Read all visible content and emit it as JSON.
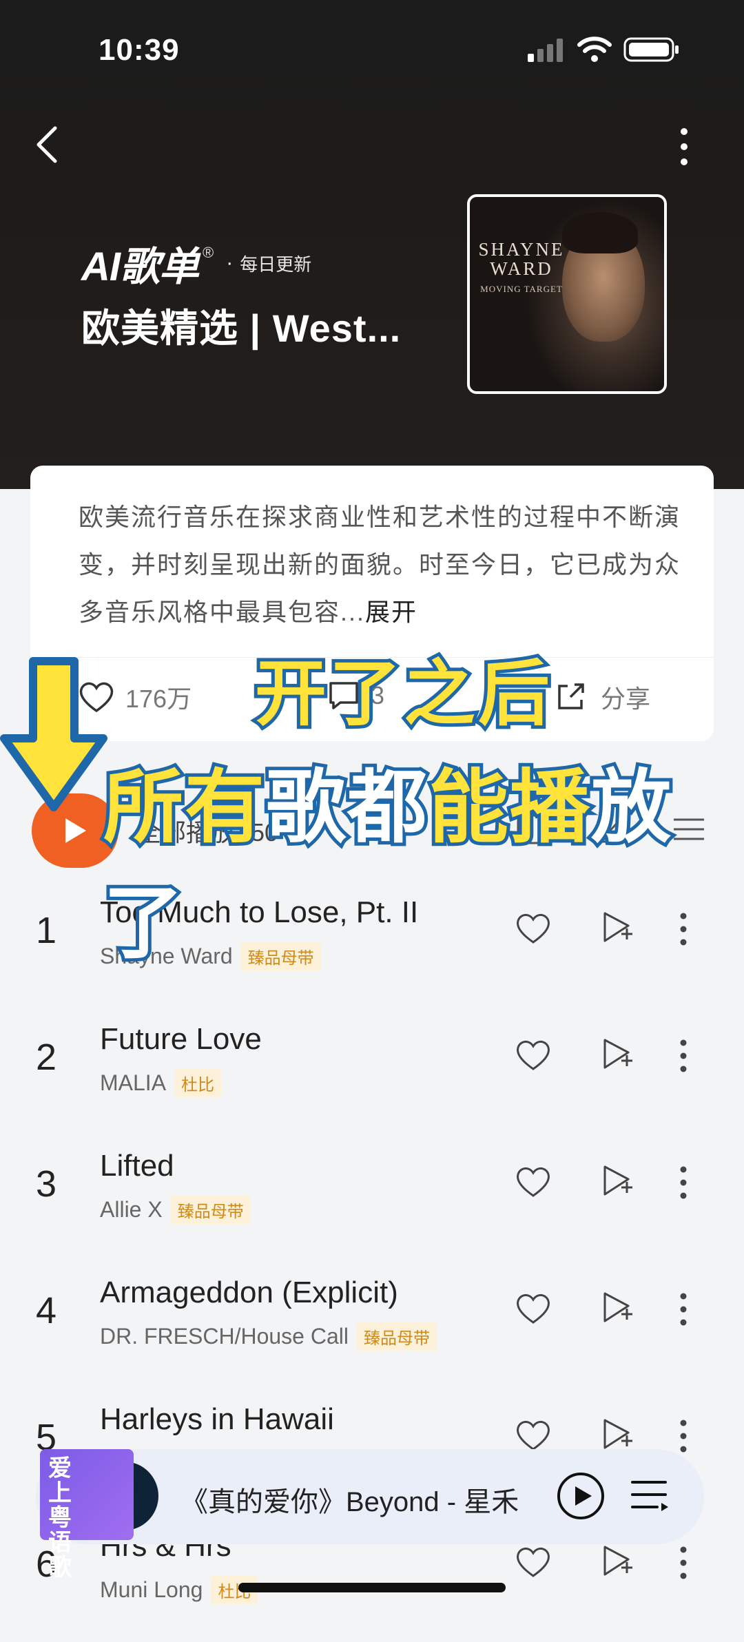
{
  "status_bar": {
    "time": "10:39"
  },
  "header": {
    "badge": "AI歌单",
    "badge_mark": "®",
    "update_label": "每日更新",
    "title": "欧美精选 | West...",
    "cover": {
      "artist": "SHAYNE WARD",
      "album": "MOVING TARGET"
    }
  },
  "description": {
    "text": "欧美流行音乐在探求商业性和艺术性的过程中不断演变，并时刻呈现出新的面貌。时至今日，它已成为众多音乐风格中最具包容...",
    "expand_label": "展开"
  },
  "actions": {
    "likes": "176万",
    "comments": "3",
    "share_label": "分享"
  },
  "play_all": {
    "label": "全部播放",
    "count": "50"
  },
  "songs": [
    {
      "index": "1",
      "title": "Too Much to Lose, Pt. II",
      "artist": "Shayne Ward",
      "tag": "臻品母带"
    },
    {
      "index": "2",
      "title": "Future Love",
      "artist": "MALIA",
      "tag": "杜比"
    },
    {
      "index": "3",
      "title": "Lifted",
      "artist": "Allie X",
      "tag": "臻品母带"
    },
    {
      "index": "4",
      "title": "Armageddon (Explicit)",
      "artist": "DR. FRESCH/House Call",
      "tag": "臻品母带"
    },
    {
      "index": "5",
      "title": "Harleys in Hawaii",
      "artist": "",
      "tag": ""
    },
    {
      "index": "6",
      "title": "Hrs & Hrs",
      "artist": "Muni Long",
      "tag": "杜比"
    }
  ],
  "overlay": {
    "line1": "开了之后",
    "line2a": "所有",
    "line2b": "歌都",
    "line2c": "能播",
    "line2d": "放了"
  },
  "mini_player": {
    "art_text": "爱上粤语歌",
    "now_playing": "《真的爱你》Beyond - 星禾"
  },
  "colors": {
    "accent": "#f06022",
    "tag_bg": "#fdf1d9",
    "tag_text": "#d08a1a",
    "overlay_yellow": "#ffe23a",
    "overlay_stroke": "#1e67a8"
  }
}
